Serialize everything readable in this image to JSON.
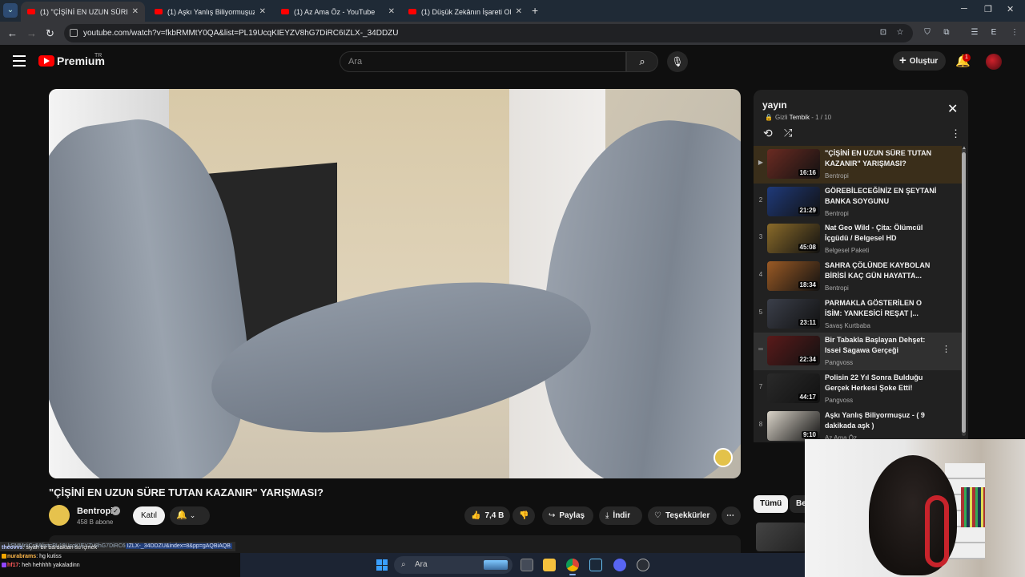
{
  "browser": {
    "tabs": [
      {
        "label": "(1) \"ÇİŞİNİ EN UZUN SÜRE TUTAN",
        "active": true
      },
      {
        "label": "(1) Aşkı Yanlış Biliyormuşuz - (9",
        "active": false
      },
      {
        "label": "(1) Az Ama Öz - YouTube",
        "active": false
      },
      {
        "label": "(1) Düşük Zekânın İşareti Olan G",
        "active": false
      }
    ],
    "url": "youtube.com/watch?v=fkbRMMtY0QA&list=PL19UcqKIEYZV8hG7DiRC6IZLX-_34DDZU",
    "profile_initial": "E"
  },
  "header": {
    "logo_text": "Premium",
    "logo_region": "TR",
    "search_placeholder": "Ara",
    "create_label": "Oluştur",
    "notification_count": "1"
  },
  "video": {
    "title": "\"ÇİŞİNİ EN UZUN SÜRE TUTAN KAZANIR\" YARIŞMASI?",
    "channel": "Bentropi",
    "subscribers": "458 B abone",
    "join_label": "Katıl",
    "likes": "7,4 B",
    "share_label": "Paylaş",
    "download_label": "İndir",
    "thanks_label": "Teşekkürler"
  },
  "playlist": {
    "title": "yayın",
    "privacy": "Gizli",
    "owner": "Tembik",
    "position": "- 1 / 10",
    "items": [
      {
        "index": "▶",
        "title": "\"ÇİŞİNİ EN UZUN SÜRE TUTAN KAZANIR\" YARIŞMASI?",
        "channel": "Bentropi",
        "duration": "16:16",
        "thumb": "#6b2b22"
      },
      {
        "index": "2",
        "title": "GÖREBİLECEĞİNİZ EN ŞEYTANİ BANKA SOYGUNU",
        "channel": "Bentropi",
        "duration": "21:29",
        "thumb": "#1f3a7a"
      },
      {
        "index": "3",
        "title": "Nat Geo Wild - Çita: Ölümcül İçgüdü / Belgesel HD",
        "channel": "Belgesel Paketi",
        "duration": "45:08",
        "thumb": "#8a6b2a"
      },
      {
        "index": "4",
        "title": "SAHRA ÇÖLÜNDE KAYBOLAN BİRİSİ KAÇ GÜN HAYATTA...",
        "channel": "Bentropi",
        "duration": "18:34",
        "thumb": "#9a5a25"
      },
      {
        "index": "5",
        "title": "PARMAKLA GÖSTERİLEN O İSİM: YANKESİCİ REŞAT |...",
        "channel": "Savaş Kurtbaba",
        "duration": "23:11",
        "thumb": "#3b3f4a"
      },
      {
        "index": "═",
        "title": "Bir Tabakla Başlayan Dehşet: Issei Sagawa Gerçeği",
        "channel": "Pangvoss",
        "duration": "22:34",
        "thumb": "#5a1a1a"
      },
      {
        "index": "7",
        "title": "Polisin 22 Yıl Sonra Bulduğu Gerçek Herkesi Şoke Etti!",
        "channel": "Pangvoss",
        "duration": "44:17",
        "thumb": "#2a2a2a"
      },
      {
        "index": "8",
        "title": "Aşkı Yanlış Biliyormuşuz - ( 9 dakikada aşk )",
        "channel": "Az Ama Öz",
        "duration": "9:10",
        "thumb": "#d9d3c8"
      },
      {
        "index": "9",
        "title": "",
        "channel": "",
        "duration": "",
        "thumb": "#e2ddd4"
      }
    ]
  },
  "chips": {
    "all": "Tümü",
    "partial": "Be"
  },
  "status_url": {
    "prefix": "...kSMMrIiCs8&list=PL19UcqKIEYZV8hG7DiRC6",
    "highlight": "IZLX-_34DDZU&index=8&pp=gAQBiAQB"
  },
  "chat": [
    {
      "user": "theovvs",
      "text": ": siyah bir bardaktan su içmek",
      "color": "#b9c7ff"
    },
    {
      "user": "nurabrams",
      "text": ": hg kutiss",
      "color": "#ffb84a"
    },
    {
      "user": "hf17",
      "text": ": heh hehhhh yakaladinn",
      "color": "#ff5a5a"
    }
  ],
  "taskbar": {
    "search_label": "Ara"
  }
}
